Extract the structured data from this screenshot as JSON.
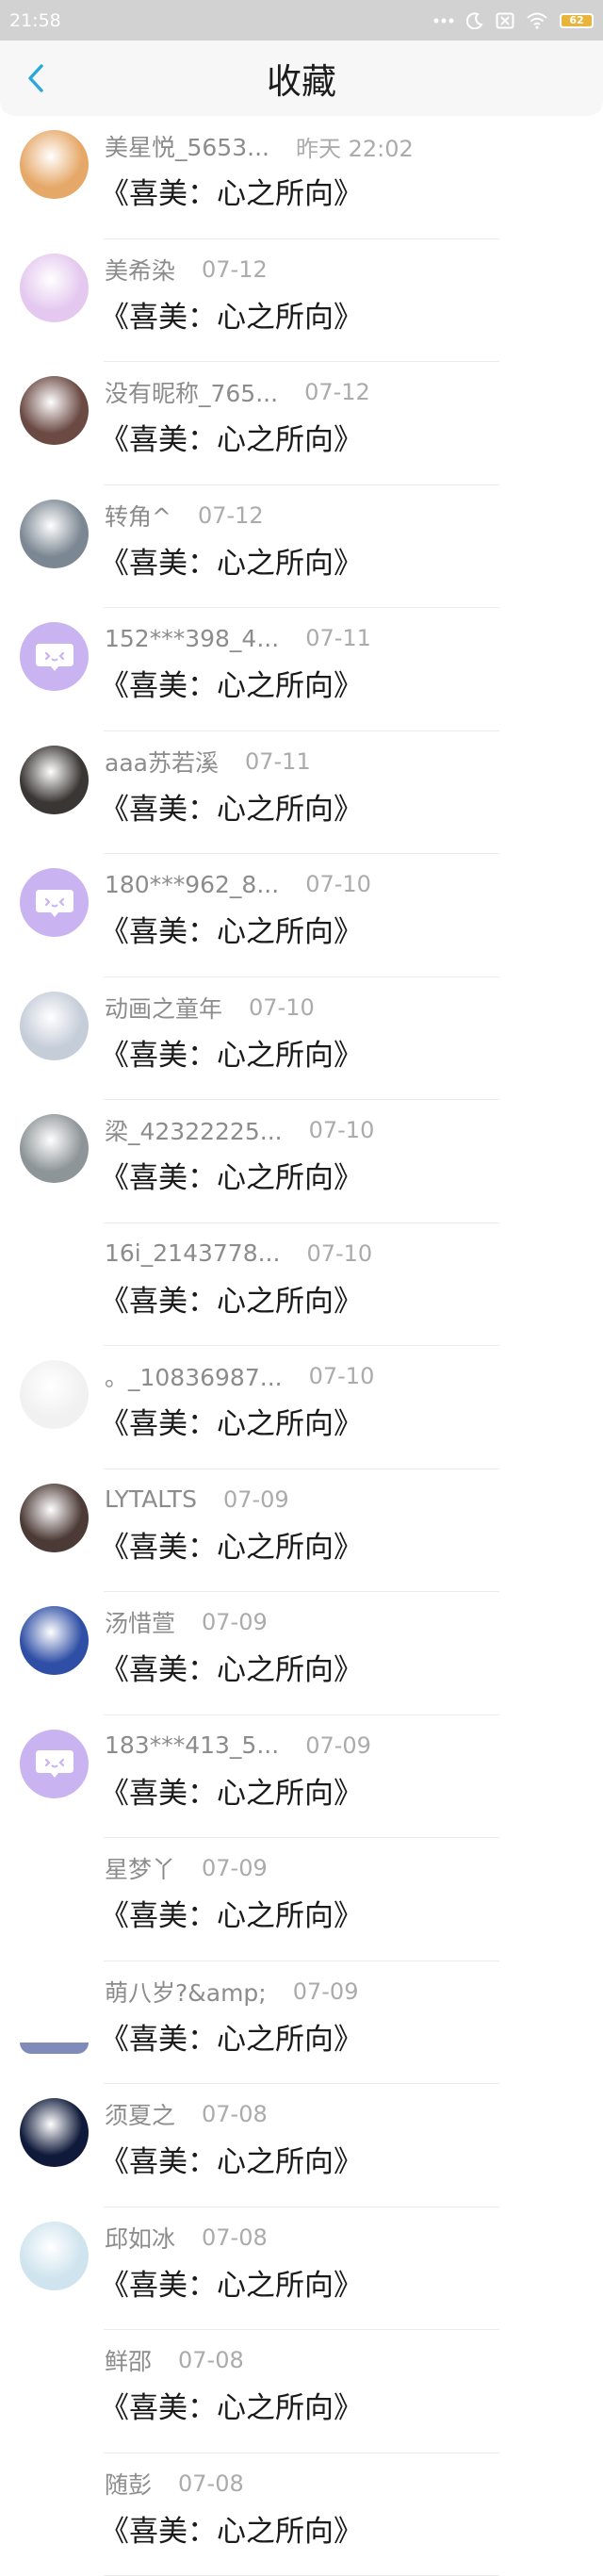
{
  "status_bar": {
    "time": "21:58",
    "battery": "62"
  },
  "header": {
    "title": "收藏"
  },
  "items": [
    {
      "name": "美星悦_5653...",
      "time": "昨天 22:02",
      "title": "《喜美：心之所向》",
      "avatar": "cartoon-girl-avatar",
      "color": "#e6a868"
    },
    {
      "name": "美希染",
      "time": "07-12",
      "title": "《喜美：心之所向》",
      "avatar": "anime-purple-avatar",
      "color": "#e4c8ef"
    },
    {
      "name": "没有昵称_765...",
      "time": "07-12",
      "title": "《喜美：心之所向》",
      "avatar": "girl-photo-avatar",
      "color": "#6b4a44"
    },
    {
      "name": "转角^",
      "time": "07-12",
      "title": "《喜美：心之所向》",
      "avatar": "beach-photo-avatar",
      "color": "#7b8792"
    },
    {
      "name": "152***398_4...",
      "time": "07-11",
      "title": "《喜美：心之所向》",
      "avatar": "default-chat-avatar",
      "color": "#c9b4f1"
    },
    {
      "name": "aaa苏若溪",
      "time": "07-11",
      "title": "《喜美：心之所向》",
      "avatar": "girl-dark-photo-avatar",
      "color": "#3a3634"
    },
    {
      "name": "180***962_8...",
      "time": "07-10",
      "title": "《喜美：心之所向》",
      "avatar": "default-chat-avatar",
      "color": "#c9b4f1"
    },
    {
      "name": "动画之童年",
      "time": "07-10",
      "title": "《喜美：心之所向》",
      "avatar": "sky-photo-avatar",
      "color": "#c5cdd9"
    },
    {
      "name": "梁_42322225...",
      "time": "07-10",
      "title": "《喜美：心之所向》",
      "avatar": "cloud-photo-avatar",
      "color": "#8e9598"
    },
    {
      "name": "16i_2143778...",
      "time": "07-10",
      "title": "《喜美：心之所向》",
      "avatar": "",
      "color": ""
    },
    {
      "name": "。_10836987...",
      "time": "07-10",
      "title": "《喜美：心之所向》",
      "avatar": "faded-text-avatar",
      "color": "#f1f1f1"
    },
    {
      "name": "LYTALTS",
      "time": "07-09",
      "title": "《喜美：心之所向》",
      "avatar": "girl-portrait-avatar",
      "color": "#4c3a36"
    },
    {
      "name": "汤惜萱",
      "time": "07-09",
      "title": "《喜美：心之所向》",
      "avatar": "blue-balloon-avatar",
      "color": "#2f4fa6"
    },
    {
      "name": "183***413_5...",
      "time": "07-09",
      "title": "《喜美：心之所向》",
      "avatar": "default-chat-avatar",
      "color": "#c9b4f1"
    },
    {
      "name": "星梦丫",
      "time": "07-09",
      "title": "《喜美：心之所向》",
      "avatar": "",
      "color": ""
    },
    {
      "name": "萌八岁?&amp;",
      "time": "07-09",
      "title": "《喜美：心之所向》",
      "avatar": "partial-avatar",
      "color": "#7f8bb8"
    },
    {
      "name": "须夏之",
      "time": "07-08",
      "title": "《喜美：心之所向》",
      "avatar": "night-sky-avatar",
      "color": "#0f1a3a"
    },
    {
      "name": "邱如冰",
      "time": "07-08",
      "title": "《喜美：心之所向》",
      "avatar": "flower-photo-avatar",
      "color": "#cfe4ee"
    },
    {
      "name": "鲜邵",
      "time": "07-08",
      "title": "《喜美：心之所向》",
      "avatar": "",
      "color": ""
    },
    {
      "name": "随彭",
      "time": "07-08",
      "title": "《喜美：心之所向》",
      "avatar": "",
      "color": ""
    }
  ]
}
